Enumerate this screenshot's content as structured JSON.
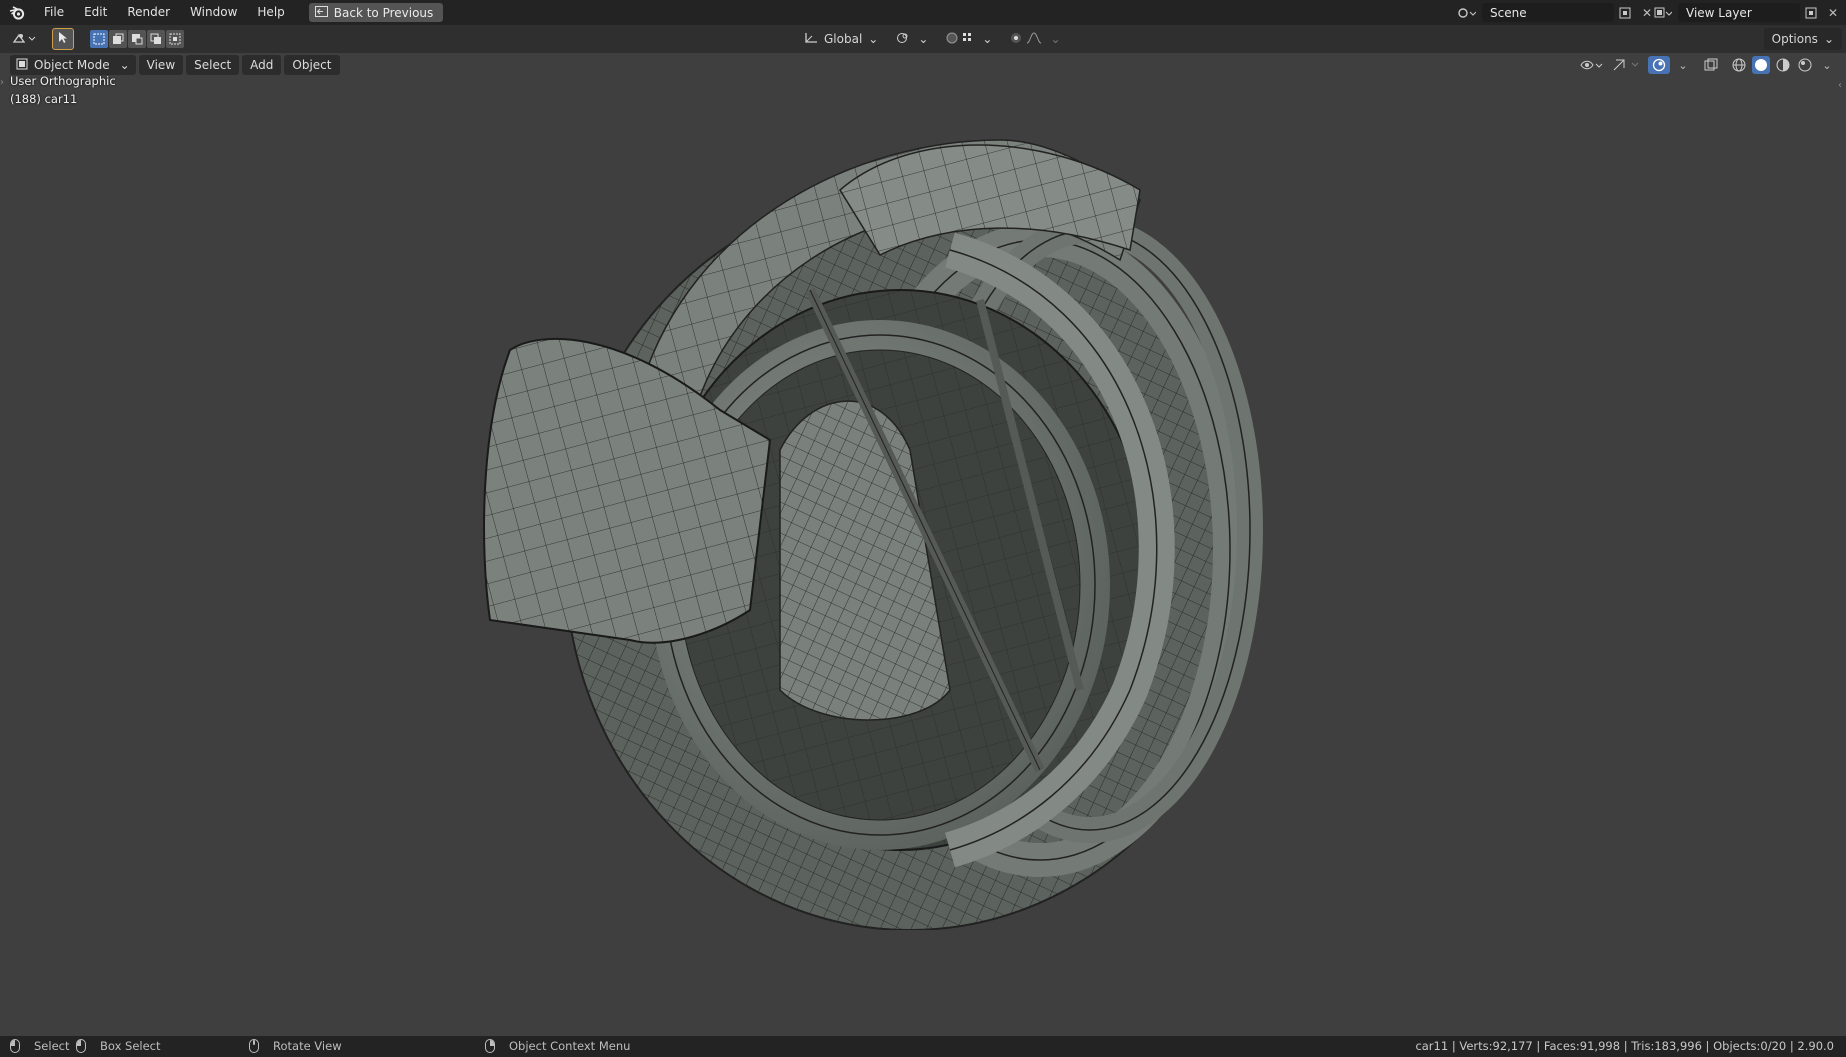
{
  "menu": {
    "items": [
      "File",
      "Edit",
      "Render",
      "Window",
      "Help"
    ],
    "back_button": "Back to Previous"
  },
  "scene": {
    "name": "Scene"
  },
  "view_layer": {
    "name": "View Layer"
  },
  "toolheader": {
    "transform_orientation": "Global",
    "options_label": "Options"
  },
  "viewheader": {
    "mode": "Object Mode",
    "menus": [
      "View",
      "Select",
      "Add",
      "Object"
    ]
  },
  "overlay": {
    "view_name": "User Orthographic",
    "object_label": "(188) car11"
  },
  "statusbar": {
    "select": "Select",
    "box_select": "Box Select",
    "rotate_view": "Rotate View",
    "context_menu": "Object Context Menu",
    "stats": "car11 | Verts:92,177 | Faces:91,998 | Tris:183,996 | Objects:0/20 | 2.90.0"
  },
  "colors": {
    "accent": "#4772b3",
    "topbar": "#232323",
    "viewport": "#3f3f3f",
    "mesh": "#6f7570"
  },
  "icons": [
    "blender-logo-icon",
    "back-icon",
    "scene-icon",
    "view-layer-icon",
    "cursor-tool-icon",
    "transform-icon",
    "pivot-icon",
    "snap-icon",
    "proportional-icon",
    "overlay-icon",
    "gizmo-icon",
    "xray-icon",
    "wireframe-shading-icon",
    "solid-shading-icon",
    "material-shading-icon",
    "rendered-shading-icon"
  ]
}
